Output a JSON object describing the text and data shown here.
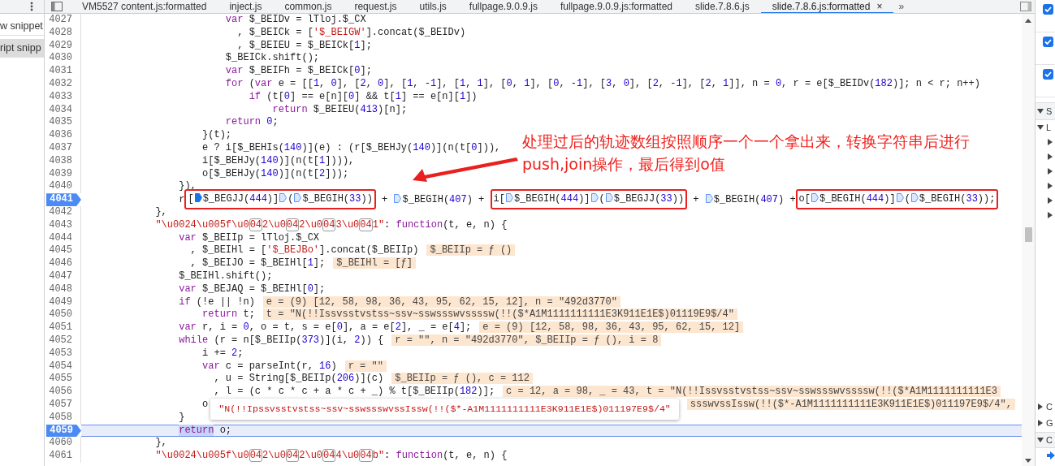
{
  "sidebar": {
    "items": [
      {
        "label": "w snippet",
        "selected": false
      },
      {
        "label": "ript snipp",
        "selected": true
      }
    ]
  },
  "tabs": [
    {
      "label": "VM5527 content.js:formatted",
      "selected": false
    },
    {
      "label": "inject.js",
      "selected": false
    },
    {
      "label": "common.js",
      "selected": false
    },
    {
      "label": "request.js",
      "selected": false
    },
    {
      "label": "utils.js",
      "selected": false
    },
    {
      "label": "fullpage.9.0.9.js",
      "selected": false
    },
    {
      "label": "fullpage.9.0.9.js:formatted",
      "selected": false
    },
    {
      "label": "slide.7.8.6.js",
      "selected": false
    },
    {
      "label": "slide.7.8.6.js:formatted",
      "selected": true,
      "close": "×"
    }
  ],
  "tabs_overflow": "»",
  "lines": [
    {
      "number": "4027",
      "breakpoint": false,
      "current": false,
      "segments": [
        {
          "kind": "code",
          "text": "                        var $_BEIDv = lTloj.$_CX"
        }
      ]
    },
    {
      "number": "4028",
      "breakpoint": false,
      "current": false,
      "segments": [
        {
          "kind": "code",
          "text": "                          , $_BEICk = ['$_BEIGW'].concat($_BEIDv)"
        }
      ]
    },
    {
      "number": "4029",
      "breakpoint": false,
      "current": false,
      "segments": [
        {
          "kind": "code",
          "text": "                          , $_BEIEU = $_BEICk[1];"
        }
      ]
    },
    {
      "number": "4030",
      "breakpoint": false,
      "current": false,
      "segments": [
        {
          "kind": "code",
          "text": "                        $_BEICk.shift();"
        }
      ]
    },
    {
      "number": "4031",
      "breakpoint": false,
      "current": false,
      "segments": [
        {
          "kind": "code",
          "text": "                        var $_BEIFh = $_BEICk[0];"
        }
      ]
    },
    {
      "number": "4032",
      "breakpoint": false,
      "current": false,
      "segments": [
        {
          "kind": "code",
          "text": "                        for (var e = [[1, 0], [2, 0], [1, -1], [1, 1], [0, 1], [0, -1], [3, 0], [2, -1], [2, 1]], n = 0, r = e[$_BEIDv(182)]; n < r; n++)"
        }
      ]
    },
    {
      "number": "4033",
      "breakpoint": false,
      "current": false,
      "segments": [
        {
          "kind": "code",
          "text": "                            if (t[0] == e[n][0] && t[1] == e[n][1])"
        }
      ]
    },
    {
      "number": "4034",
      "breakpoint": false,
      "current": false,
      "segments": [
        {
          "kind": "code",
          "text": "                                return $_BEIEU(413)[n];"
        }
      ]
    },
    {
      "number": "4035",
      "breakpoint": false,
      "current": false,
      "segments": [
        {
          "kind": "code",
          "text": "                        return 0;"
        }
      ]
    },
    {
      "number": "4036",
      "breakpoint": false,
      "current": false,
      "segments": [
        {
          "kind": "code",
          "text": "                    }(t);"
        }
      ]
    },
    {
      "number": "4037",
      "breakpoint": false,
      "current": false,
      "segments": [
        {
          "kind": "code",
          "text": "                    e ? i[$_BEHIs(140)](e) : (r[$_BEHJy(140)](n(t[0])),"
        }
      ]
    },
    {
      "number": "4038",
      "breakpoint": false,
      "current": false,
      "segments": [
        {
          "kind": "code",
          "text": "                    i[$_BEHJy(140)](n(t[1]))),"
        }
      ]
    },
    {
      "number": "4039",
      "breakpoint": false,
      "current": false,
      "segments": [
        {
          "kind": "code",
          "text": "                    o[$_BEHJy(140)](n(t[2]));"
        }
      ]
    },
    {
      "number": "4040",
      "breakpoint": false,
      "current": false,
      "segments": [
        {
          "kind": "code",
          "text": "                }),"
        }
      ]
    },
    {
      "number": "4041",
      "breakpoint": true,
      "current": false,
      "segments": [
        {
          "kind": "code",
          "text": "                r"
        },
        {
          "kind": "redbox",
          "segments": [
            {
              "kind": "code",
              "text": "["
            },
            {
              "kind": "bp",
              "active": true
            },
            {
              "kind": "code",
              "text": "$_BEGJJ(444)]"
            },
            {
              "kind": "bp",
              "active": false
            },
            {
              "kind": "code",
              "text": "("
            },
            {
              "kind": "bp",
              "active": false
            },
            {
              "kind": "code",
              "text": "$_BEGIH(33))"
            }
          ]
        },
        {
          "kind": "code",
          "text": " + "
        },
        {
          "kind": "bp",
          "active": false
        },
        {
          "kind": "code",
          "text": "$_BEGIH(407) + "
        },
        {
          "kind": "redbox",
          "segments": [
            {
              "kind": "code",
              "text": "i["
            },
            {
              "kind": "bp",
              "active": false
            },
            {
              "kind": "code",
              "text": "$_BEGIH(444)]"
            },
            {
              "kind": "bp",
              "active": false
            },
            {
              "kind": "code",
              "text": "("
            },
            {
              "kind": "bp",
              "active": false
            },
            {
              "kind": "code",
              "text": "$_BEGJJ(33))"
            }
          ]
        },
        {
          "kind": "code",
          "text": " + "
        },
        {
          "kind": "bp",
          "active": false
        },
        {
          "kind": "code",
          "text": "$_BEGIH(407) +"
        },
        {
          "kind": "redbox",
          "segments": [
            {
              "kind": "code",
              "text": "o["
            },
            {
              "kind": "bp",
              "active": false
            },
            {
              "kind": "code",
              "text": "$_BEGIH(444)]"
            },
            {
              "kind": "bp",
              "active": false
            },
            {
              "kind": "code",
              "text": "("
            },
            {
              "kind": "bp",
              "active": false
            },
            {
              "kind": "code",
              "text": "$_BEGIH(33));"
            }
          ]
        }
      ]
    },
    {
      "number": "4042",
      "breakpoint": false,
      "current": false,
      "segments": [
        {
          "kind": "code",
          "text": "            },"
        }
      ]
    },
    {
      "number": "4043",
      "breakpoint": false,
      "current": false,
      "segments": [
        {
          "kind": "string",
          "text": "            \"\\u0024\\u005f\\u0"
        },
        {
          "kind": "boxed",
          "text": "04"
        },
        {
          "kind": "string",
          "text": "2\\u0"
        },
        {
          "kind": "boxed",
          "text": "04"
        },
        {
          "kind": "string",
          "text": "2\\u0"
        },
        {
          "kind": "boxed",
          "text": "04"
        },
        {
          "kind": "string",
          "text": "3\\u0"
        },
        {
          "kind": "boxed",
          "text": "04"
        },
        {
          "kind": "string",
          "text": "1\""
        },
        {
          "kind": "code",
          "text": ": function(t, e, n) {"
        }
      ]
    },
    {
      "number": "4044",
      "breakpoint": false,
      "current": false,
      "segments": [
        {
          "kind": "code",
          "text": "                var $_BEIIp = lTloj.$_CX"
        }
      ]
    },
    {
      "number": "4045",
      "breakpoint": false,
      "current": false,
      "segments": [
        {
          "kind": "code",
          "text": "                  , $_BEIHl = ['$_BEJBo'].concat($_BEIIp)"
        },
        {
          "kind": "value",
          "text": "$_BEIIp = ƒ ()"
        }
      ]
    },
    {
      "number": "4046",
      "breakpoint": false,
      "current": false,
      "segments": [
        {
          "kind": "code",
          "text": "                  , $_BEIJO = $_BEIHl[1];"
        },
        {
          "kind": "value",
          "text": "$_BEIHl = [ƒ]"
        }
      ]
    },
    {
      "number": "4047",
      "breakpoint": false,
      "current": false,
      "segments": [
        {
          "kind": "code",
          "text": "                $_BEIHl.shift();"
        }
      ]
    },
    {
      "number": "4048",
      "breakpoint": false,
      "current": false,
      "segments": [
        {
          "kind": "code",
          "text": "                var $_BEJAQ = $_BEIHl[0];"
        }
      ]
    },
    {
      "number": "4049",
      "breakpoint": false,
      "current": false,
      "segments": [
        {
          "kind": "code",
          "text": "                if (!e || !n)"
        },
        {
          "kind": "value",
          "text": "e = (9) [12, 58, 98, 36, 43, 95, 62, 15, 12], n = \"492d3770\""
        }
      ]
    },
    {
      "number": "4050",
      "breakpoint": false,
      "current": false,
      "segments": [
        {
          "kind": "code",
          "text": "                    return t;"
        },
        {
          "kind": "value",
          "text": "t = \"N(!!Issvsstvstss~ssv~sswssswvssssw(!!($*A1M1111111111E3K911E1E$)01119E9$/4\""
        }
      ]
    },
    {
      "number": "4051",
      "breakpoint": false,
      "current": false,
      "segments": [
        {
          "kind": "code",
          "text": "                var r, i = 0, o = t, s = e[0], a = e[2], _ = e[4];"
        },
        {
          "kind": "value",
          "text": "e = (9) [12, 58, 98, 36, 43, 95, 62, 15, 12]"
        }
      ]
    },
    {
      "number": "4052",
      "breakpoint": false,
      "current": false,
      "segments": [
        {
          "kind": "code",
          "text": "                while (r = n[$_BEIIp(373)](i, 2)) {"
        },
        {
          "kind": "value",
          "text": "r = \"\", n = \"492d3770\", $_BEIIp = ƒ (), i = 8"
        }
      ]
    },
    {
      "number": "4053",
      "breakpoint": false,
      "current": false,
      "segments": [
        {
          "kind": "code",
          "text": "                    i += 2;"
        }
      ]
    },
    {
      "number": "4054",
      "breakpoint": false,
      "current": false,
      "segments": [
        {
          "kind": "code",
          "text": "                    var c = parseInt(r, 16)"
        },
        {
          "kind": "value",
          "text": "r = \"\""
        }
      ]
    },
    {
      "number": "4055",
      "breakpoint": false,
      "current": false,
      "segments": [
        {
          "kind": "code",
          "text": "                      , u = String[$_BEIIp(206)](c)"
        },
        {
          "kind": "value",
          "text": "$_BEIIp = ƒ (), c = 112"
        }
      ]
    },
    {
      "number": "4056",
      "breakpoint": false,
      "current": false,
      "segments": [
        {
          "kind": "code",
          "text": "                      , l = (c * c * c + a * c + _) % t[$_BEIIp(182)];"
        },
        {
          "kind": "value",
          "text": "c = 12, a = 98, _ = 43, t = \"N(!!Issvsstvstss~ssv~sswssswvssssw(!!($*A1M1111111111E3"
        }
      ]
    },
    {
      "number": "4057",
      "breakpoint": false,
      "current": false,
      "segments": [
        {
          "kind": "code",
          "text": "                    o"
        },
        {
          "kind": "tooltip",
          "text": "\"N(!!Ipssvsstvstss~ssv~sswssswvssIssw(!!($*-A1M1111111111E3K911E1E$)011197E9$/4\""
        },
        {
          "kind": "value",
          "text": "ssswvssIssw(!!($*-A1M1111111111E3K911E1E$)011197E9$/4\","
        }
      ]
    },
    {
      "number": "4058",
      "breakpoint": false,
      "current": false,
      "segments": [
        {
          "kind": "code",
          "text": "                }"
        }
      ]
    },
    {
      "number": "4059",
      "breakpoint": true,
      "current": true,
      "segments": [
        {
          "kind": "code",
          "text": "                return o;"
        }
      ]
    },
    {
      "number": "4060",
      "breakpoint": false,
      "current": false,
      "segments": [
        {
          "kind": "code",
          "text": "            },"
        }
      ]
    },
    {
      "number": "4061",
      "breakpoint": false,
      "current": false,
      "segments": [
        {
          "kind": "string",
          "text": "            \"\\u0024\\u005f\\u0"
        },
        {
          "kind": "boxed",
          "text": "04"
        },
        {
          "kind": "string",
          "text": "2\\u0"
        },
        {
          "kind": "boxed",
          "text": "04"
        },
        {
          "kind": "string",
          "text": "2\\u0"
        },
        {
          "kind": "boxed",
          "text": "04"
        },
        {
          "kind": "string",
          "text": "4\\u0"
        },
        {
          "kind": "boxed",
          "text": "04"
        },
        {
          "kind": "string",
          "text": "b\""
        },
        {
          "kind": "code",
          "text": ": function(t, e, n) {"
        }
      ]
    }
  ],
  "callout": {
    "text": "处理过后的轨迹数组按照顺序一个一个拿出来，转换字符串后进行\npush,join操作，最后得到o值"
  },
  "right_panel": {
    "checkboxes": [
      {
        "checked": true
      },
      {
        "checked": true
      },
      {
        "checked": true
      }
    ],
    "sections": [
      {
        "label": "S",
        "expanded": true,
        "children": [
          {
            "label": "L",
            "expanded": true,
            "children": [
              {
                "expanded": false
              },
              {
                "expanded": false
              },
              {
                "expanded": false
              },
              {
                "expanded": false
              },
              {
                "expanded": false
              },
              {
                "expanded": false
              }
            ]
          }
        ]
      }
    ],
    "bottom_sections": [
      {
        "label": "C",
        "expanded": false
      },
      {
        "label": "G",
        "expanded": false
      },
      {
        "label": "C",
        "expanded": true
      }
    ]
  }
}
